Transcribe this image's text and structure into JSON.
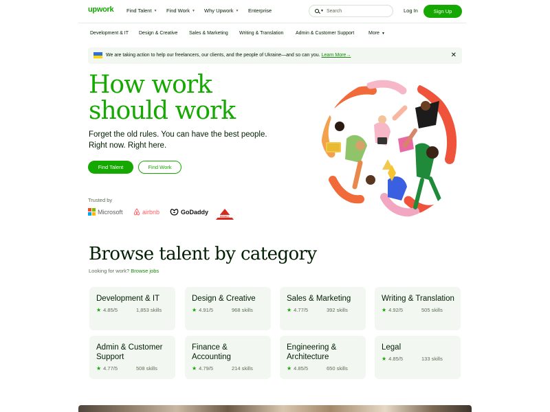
{
  "header": {
    "logo": "upwork",
    "nav": [
      {
        "label": "Find Talent",
        "dropdown": true
      },
      {
        "label": "Find Work",
        "dropdown": true
      },
      {
        "label": "Why Upwork",
        "dropdown": true
      },
      {
        "label": "Enterprise",
        "dropdown": false
      }
    ],
    "search_placeholder": "Search",
    "login": "Log In",
    "signup": "Sign Up"
  },
  "categories_nav": [
    "Development & IT",
    "Design & Creative",
    "Sales & Marketing",
    "Writing & Translation",
    "Admin & Customer Support",
    "More"
  ],
  "banner": {
    "text": "We are taking action to help our freelancers, our clients, and the people of Ukraine—and so can you.",
    "link": "Learn More",
    "link_arrow": "→"
  },
  "hero": {
    "title_line1": "How work",
    "title_line2": "should work",
    "sub_line1": "Forget the old rules. You can have the best people.",
    "sub_line2": "Right now. Right here.",
    "btn_find_talent": "Find Talent",
    "btn_find_work": "Find Work",
    "trusted_by": "Trusted by",
    "brands": [
      "Microsoft",
      "airbnb",
      "GoDaddy",
      "BISSELL"
    ]
  },
  "browse": {
    "title": "Browse talent by category",
    "sub_prefix": "Looking for work?",
    "sub_link": "Browse jobs",
    "cards": [
      {
        "title": "Development & IT",
        "rating": "4.85/5",
        "skills": "1,853 skills"
      },
      {
        "title": "Design & Creative",
        "rating": "4.91/5",
        "skills": "968 skills"
      },
      {
        "title": "Sales & Marketing",
        "rating": "4.77/5",
        "skills": "392 skills"
      },
      {
        "title": "Writing & Translation",
        "rating": "4.92/5",
        "skills": "505 skills"
      },
      {
        "title": "Admin & Customer Support",
        "rating": "4.77/5",
        "skills": "508 skills"
      },
      {
        "title": "Finance & Accounting",
        "rating": "4.79/5",
        "skills": "214 skills"
      },
      {
        "title": "Engineering & Architecture",
        "rating": "4.85/5",
        "skills": "650 skills"
      },
      {
        "title": "Legal",
        "rating": "4.85/5",
        "skills": "133 skills"
      }
    ]
  },
  "colors": {
    "brand_green": "#14a800",
    "link_green": "#108a00",
    "card_bg": "#f2f7f2",
    "text_dark": "#001e00"
  }
}
